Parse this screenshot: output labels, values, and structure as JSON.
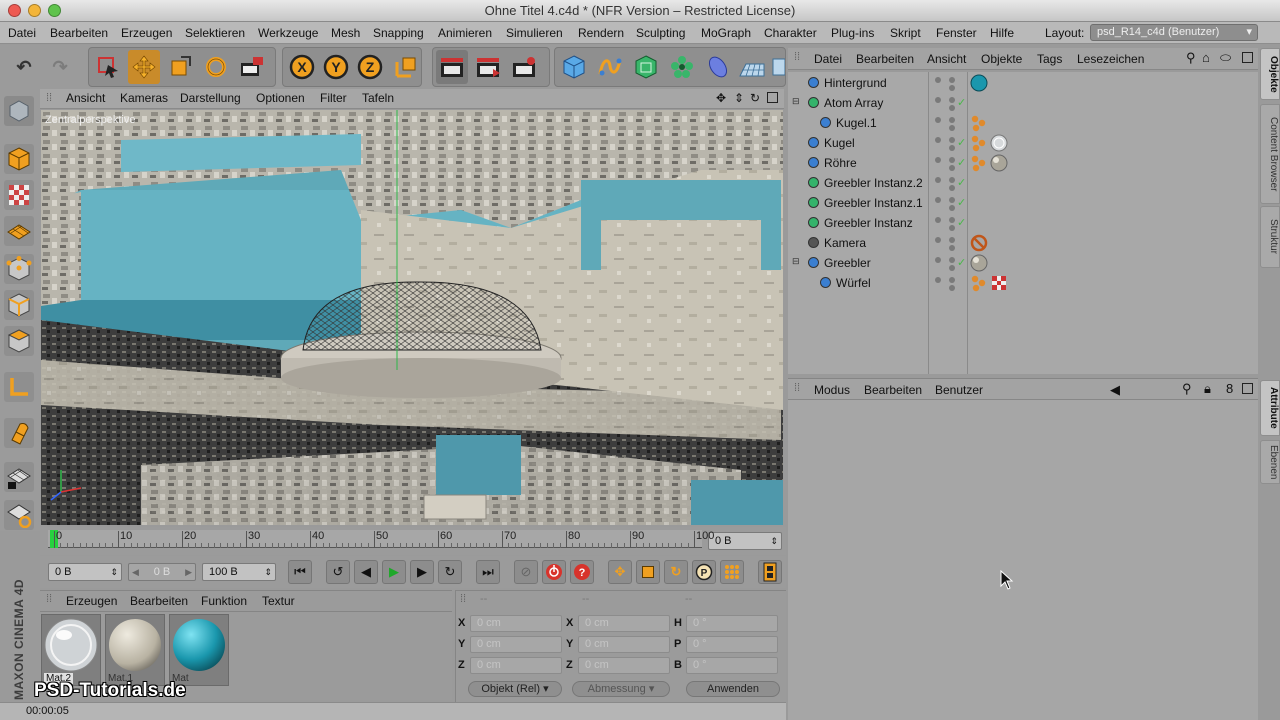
{
  "window": {
    "title": "Ohne Titel 4.c4d * (NFR Version – Restricted License)"
  },
  "menubar": {
    "items": [
      "Datei",
      "Bearbeiten",
      "Erzeugen",
      "Selektieren",
      "Werkzeuge",
      "Mesh",
      "Snapping",
      "Animieren",
      "Simulieren",
      "Rendern",
      "Sculpting",
      "MoGraph",
      "Charakter",
      "Plug-ins",
      "Skript",
      "Fenster",
      "Hilfe"
    ],
    "layout_label": "Layout:",
    "layout_value": "psd_R14_c4d (Benutzer)"
  },
  "viewport": {
    "menu": [
      "Ansicht",
      "Kameras",
      "Darstellung",
      "Optionen",
      "Filter",
      "Tafeln"
    ],
    "camera_label": "Zentralperspektive"
  },
  "timeline": {
    "ticks": [
      "0",
      "10",
      "20",
      "30",
      "40",
      "50",
      "60",
      "70",
      "80",
      "90",
      "100"
    ],
    "current_frame": "0 B",
    "playhead_fraction": 0.0
  },
  "transport": {
    "start_field": "0 B",
    "preview_field": "0 B",
    "end_field": "100 B"
  },
  "material_manager": {
    "menu": [
      "Erzeugen",
      "Bearbeiten",
      "Funktion",
      "Textur"
    ],
    "materials": [
      {
        "label": "Mat.2",
        "kind": "glass"
      },
      {
        "label": "Mat.1",
        "kind": "concrete"
      },
      {
        "label": "Mat",
        "kind": "cyan"
      }
    ],
    "watermark": "PSD-Tutorials.de",
    "brand": "MAXON CINEMA 4D"
  },
  "coordinates": {
    "headers": [
      "--",
      "--",
      "--"
    ],
    "rows": [
      {
        "l1": "X",
        "v1": "0 cm",
        "l2": "X",
        "v2": "0 cm",
        "l3": "H",
        "v3": "0 °"
      },
      {
        "l1": "Y",
        "v1": "0 cm",
        "l2": "Y",
        "v2": "0 cm",
        "l3": "P",
        "v3": "0 °"
      },
      {
        "l1": "Z",
        "v1": "0 cm",
        "l2": "Z",
        "v2": "0 cm",
        "l3": "B",
        "v3": "0 °"
      }
    ],
    "mode_select": "Objekt (Rel)",
    "size_select": "Abmessung",
    "apply_button": "Anwenden"
  },
  "status": {
    "time": "00:00:05"
  },
  "object_manager": {
    "menu": [
      "Datei",
      "Bearbeiten",
      "Ansicht",
      "Objekte",
      "Tags",
      "Lesezeichen"
    ],
    "objects": [
      {
        "name": "Hintergrund",
        "indent": 0,
        "icon_color": "#3b7fd1",
        "check": false,
        "tags": [
          "cyan-ball"
        ]
      },
      {
        "name": "Atom Array",
        "indent": 0,
        "icon_color": "#34b36b",
        "check": true,
        "tags": []
      },
      {
        "name": "Kugel.1",
        "indent": 1,
        "icon_color": "#3b7fd1",
        "check": false,
        "tags": [
          "phong"
        ]
      },
      {
        "name": "Kugel",
        "indent": 0,
        "icon_color": "#3b7fd1",
        "check": true,
        "tags": [
          "phong",
          "glass-ball"
        ]
      },
      {
        "name": "Röhre",
        "indent": 0,
        "icon_color": "#3b7fd1",
        "check": true,
        "tags": [
          "phong",
          "grey-ball"
        ]
      },
      {
        "name": "Greebler Instanz.2",
        "indent": 0,
        "icon_color": "#34b36b",
        "check": true,
        "tags": []
      },
      {
        "name": "Greebler Instanz.1",
        "indent": 0,
        "icon_color": "#34b36b",
        "check": true,
        "tags": []
      },
      {
        "name": "Greebler Instanz",
        "indent": 0,
        "icon_color": "#34b36b",
        "check": true,
        "tags": []
      },
      {
        "name": "Kamera",
        "indent": 0,
        "icon_color": "#555555",
        "check": false,
        "tags": [
          "protection"
        ]
      },
      {
        "name": "Greebler",
        "indent": 0,
        "icon_color": "#3b7fd1",
        "check": true,
        "tags": [
          "grey-ball"
        ]
      },
      {
        "name": "Würfel",
        "indent": 1,
        "icon_color": "#3b7fd1",
        "check": false,
        "tags": [
          "phong",
          "checker"
        ]
      }
    ]
  },
  "attribute_manager": {
    "menu": [
      "Modus",
      "Bearbeiten",
      "Benutzer"
    ]
  },
  "side_tabs": {
    "top": [
      "Objekte",
      "Content Browser",
      "Struktur"
    ],
    "bottom": [
      "Attribute",
      "Ebenen"
    ]
  },
  "colors": {
    "accent_orange": "#f0a020",
    "play_green": "#1fa82a",
    "record_red": "#d8332c",
    "sky": "#5fa9b8"
  }
}
